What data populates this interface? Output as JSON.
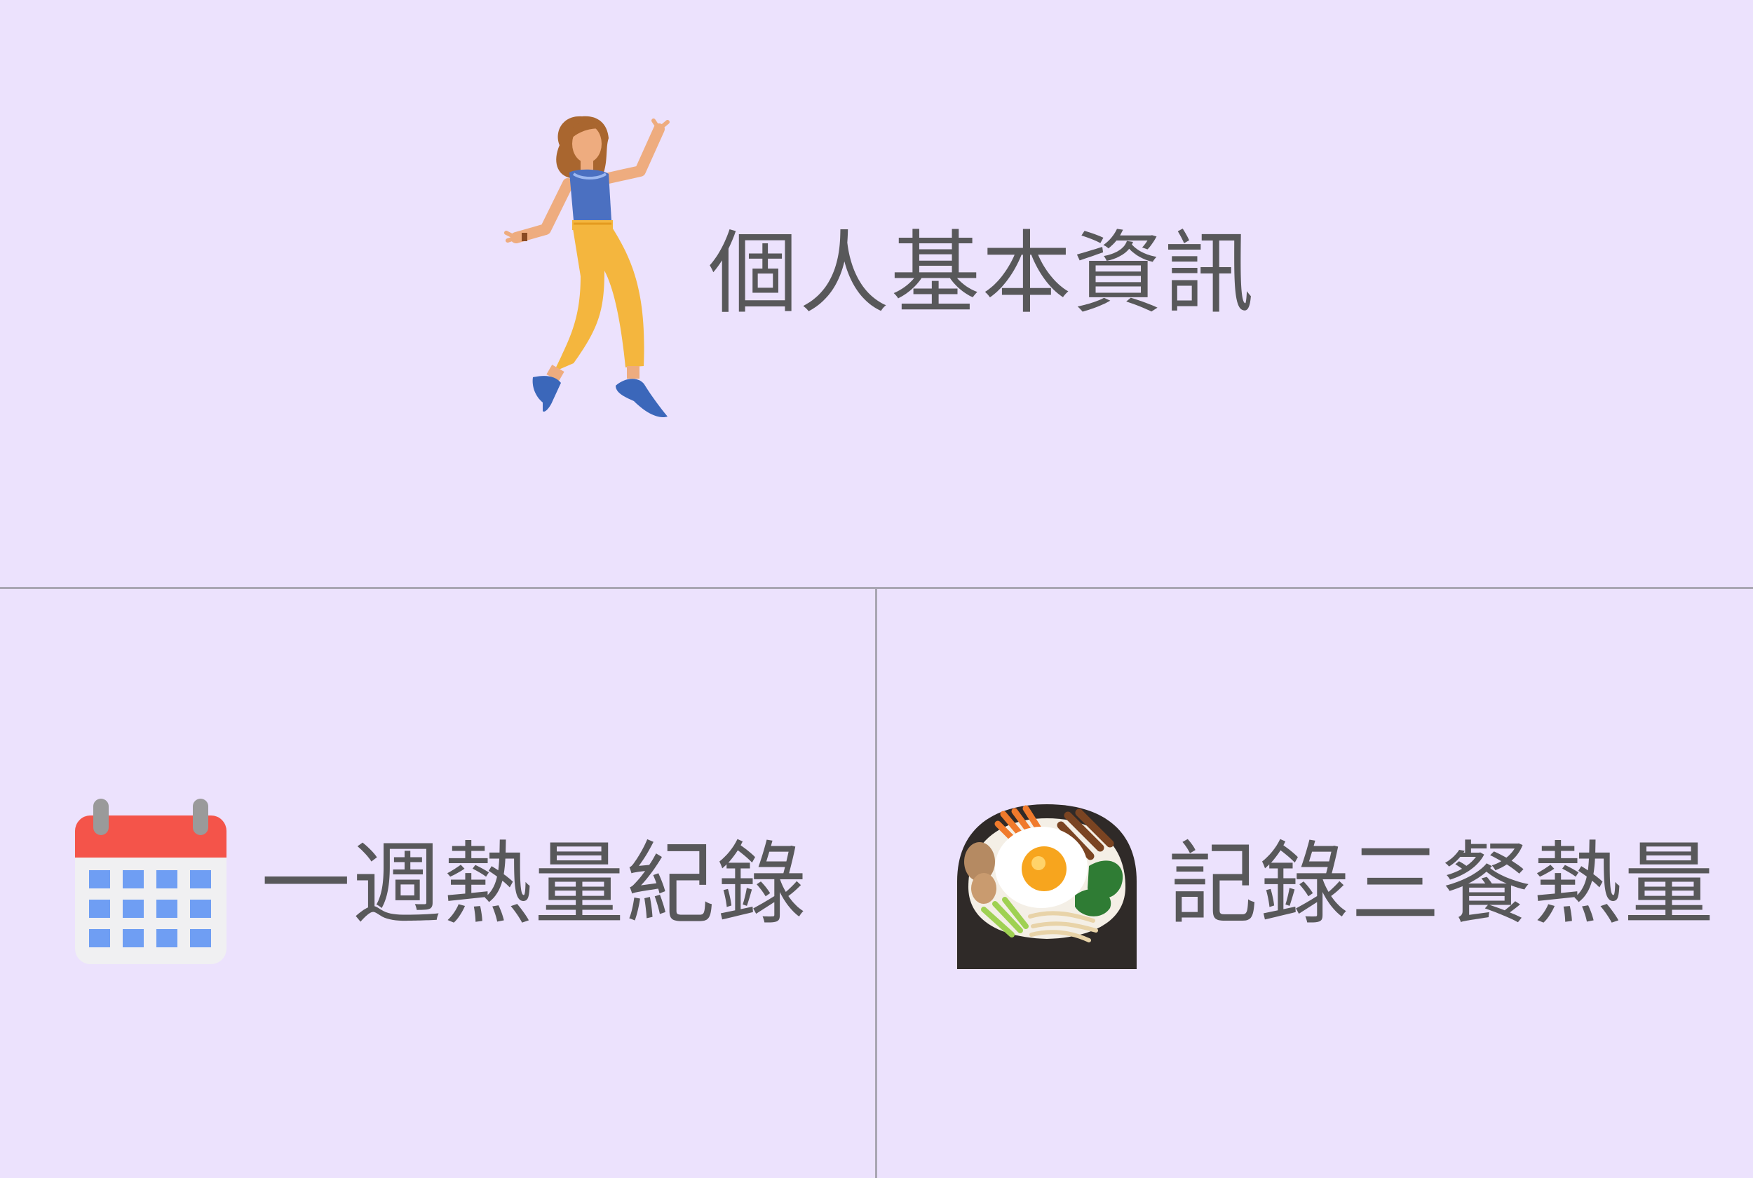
{
  "menu": {
    "profile": {
      "label": "個人基本資訊",
      "icon": "dancing-woman-icon"
    },
    "weekly": {
      "label": "一週熱量紀錄",
      "icon": "calendar-icon"
    },
    "meals": {
      "label": "記錄三餐熱量",
      "icon": "bibimbap-bowl-icon"
    }
  },
  "colors": {
    "background": "#ece2fd",
    "text": "#58585a",
    "divider": "#a9a6b3",
    "calendar_header": "#f4544a",
    "calendar_grid": "#6f9ef3",
    "tank_top": "#4b70c1",
    "pants": "#f4b63e",
    "shoes": "#3b67ba",
    "hair": "#a9662f",
    "skin": "#eeac7f"
  }
}
